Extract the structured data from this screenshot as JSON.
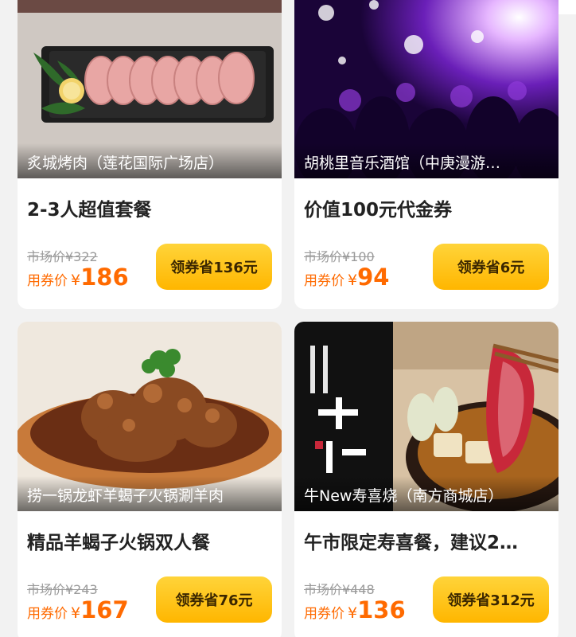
{
  "cards": [
    {
      "shop": "炙城烤肉（莲花国际广场店）",
      "title": "2-3人超值套餐",
      "market": "市场价¥322",
      "coupon_label": "用券价",
      "currency": "¥",
      "price": "186",
      "button": "领券省136元"
    },
    {
      "shop": "胡桃里音乐酒馆（中庚漫游…",
      "title": "价值100元代金券",
      "market": "市场价¥100",
      "coupon_label": "用券价",
      "currency": "¥",
      "price": "94",
      "button": "领券省6元"
    },
    {
      "shop": "捞一锅龙虾羊蝎子火锅涮羊肉",
      "title": "精品羊蝎子火锅双人餐",
      "market": "市场价¥243",
      "coupon_label": "用券价",
      "currency": "¥",
      "price": "167",
      "button": "领券省76元"
    },
    {
      "shop": "牛New寿喜烧（南方商城店）",
      "title": "午市限定寿喜餐，建议2…",
      "market": "市场价¥448",
      "coupon_label": "用券价",
      "currency": "¥",
      "price": "136",
      "button": "领券省312元"
    }
  ],
  "colors": {
    "accent_price": "#ff6a00",
    "button_top": "#ffd43a",
    "button_bottom": "#ffb600"
  },
  "images": {
    "card0": "grilled-meat-plate",
    "card1": "music-bar-crowd",
    "card2": "lamb-spine-hotpot",
    "card3": "sukiyaki-brand-photo"
  }
}
